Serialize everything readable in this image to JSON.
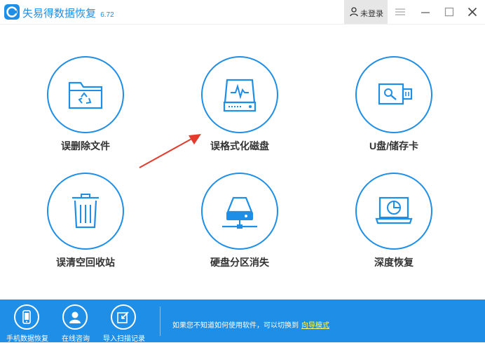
{
  "app": {
    "title": "失易得数据恢复",
    "version": "6.72"
  },
  "header": {
    "user_label": "未登录"
  },
  "tiles": [
    {
      "label": "误删除文件"
    },
    {
      "label": "误格式化磁盘"
    },
    {
      "label": "U盘/储存卡"
    },
    {
      "label": "误清空回收站"
    },
    {
      "label": "硬盘分区消失"
    },
    {
      "label": "深度恢复"
    }
  ],
  "footer": {
    "items": [
      {
        "label": "手机数据恢复"
      },
      {
        "label": "在线咨询"
      },
      {
        "label": "导入扫描记录"
      }
    ],
    "hint_text": "如果您不知道如何使用软件，可以切换到",
    "link_text": "向导模式"
  },
  "colors": {
    "accent": "#1f8ee6",
    "arrow": "#e53a2e",
    "link": "#ffff66"
  }
}
